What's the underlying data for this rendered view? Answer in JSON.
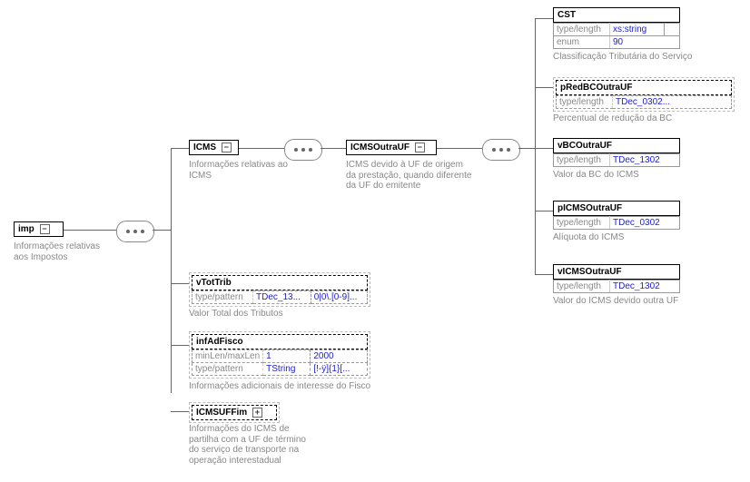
{
  "imp": {
    "name": "imp",
    "desc": "Informações relativas aos Impostos"
  },
  "icms": {
    "name": "ICMS",
    "desc": "Informações relativas ao ICMS"
  },
  "icmsOutraUF": {
    "name": "ICMSOutraUF",
    "desc": "ICMS devido à UF de origem da prestação, quando diferente da UF do emitente"
  },
  "vTotTrib": {
    "name": "vTotTrib",
    "attr_label": "type/pattern",
    "attr_val1": "TDec_13...",
    "attr_val2": "0|0\\.[0-9]...",
    "desc": "Valor Total dos Tributos"
  },
  "infAdFisco": {
    "name": "infAdFisco",
    "row1_label": "minLen/maxLen",
    "row1_val1": "1",
    "row1_val2": "2000",
    "row2_label": "type/pattern",
    "row2_val1": "TString",
    "row2_val2": "[!-ÿ]{1}[...",
    "desc": "Informações adicionais de interesse do Fisco"
  },
  "icmsUFFim": {
    "name": "ICMSUFFim",
    "desc": "Informações do ICMS de partilha com a UF de término do serviço de transporte na operação interestadual"
  },
  "cst": {
    "name": "CST",
    "row1_label": "type/length",
    "row1_val1": "xs:string",
    "row1_val2": "",
    "row2_label": "enum",
    "row2_val1": "90",
    "desc": "Classificação Tributária do Serviço"
  },
  "pRedBCOutraUF": {
    "name": "pRedBCOutraUF",
    "attr_label": "type/length",
    "attr_val1": "TDec_0302...",
    "desc": "Percentual de redução da BC"
  },
  "vBCOutraUF": {
    "name": "vBCOutraUF",
    "attr_label": "type/length",
    "attr_val1": "TDec_1302",
    "desc": "Valor da BC do ICMS"
  },
  "pICMSOutraUF": {
    "name": "pICMSOutraUF",
    "attr_label": "type/length",
    "attr_val1": "TDec_0302",
    "desc": "Alíquota do ICMS"
  },
  "vICMSOutraUF": {
    "name": "vICMSOutraUF",
    "attr_label": "type/length",
    "attr_val1": "TDec_1302",
    "desc": "Valor do ICMS devido outra UF"
  }
}
